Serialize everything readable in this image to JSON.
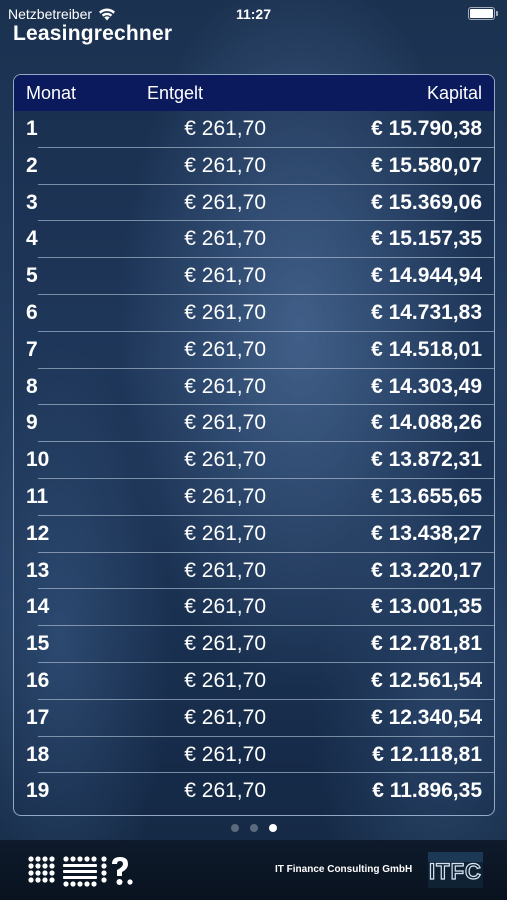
{
  "status_bar": {
    "carrier": "Netzbetreiber",
    "time": "11:27"
  },
  "app": {
    "title": "Leasingrechner"
  },
  "table": {
    "headers": {
      "month": "Monat",
      "fee": "Entgelt",
      "capital": "Kapital"
    },
    "rows": [
      {
        "month": "1",
        "fee": "€ 261,70",
        "capital": "€ 15.790,38"
      },
      {
        "month": "2",
        "fee": "€ 261,70",
        "capital": "€ 15.580,07"
      },
      {
        "month": "3",
        "fee": "€ 261,70",
        "capital": "€ 15.369,06"
      },
      {
        "month": "4",
        "fee": "€ 261,70",
        "capital": "€ 15.157,35"
      },
      {
        "month": "5",
        "fee": "€ 261,70",
        "capital": "€ 14.944,94"
      },
      {
        "month": "6",
        "fee": "€ 261,70",
        "capital": "€ 14.731,83"
      },
      {
        "month": "7",
        "fee": "€ 261,70",
        "capital": "€ 14.518,01"
      },
      {
        "month": "8",
        "fee": "€ 261,70",
        "capital": "€ 14.303,49"
      },
      {
        "month": "9",
        "fee": "€ 261,70",
        "capital": "€ 14.088,26"
      },
      {
        "month": "10",
        "fee": "€ 261,70",
        "capital": "€ 13.872,31"
      },
      {
        "month": "11",
        "fee": "€ 261,70",
        "capital": "€ 13.655,65"
      },
      {
        "month": "12",
        "fee": "€ 261,70",
        "capital": "€ 13.438,27"
      },
      {
        "month": "13",
        "fee": "€ 261,70",
        "capital": "€ 13.220,17"
      },
      {
        "month": "14",
        "fee": "€ 261,70",
        "capital": "€ 13.001,35"
      },
      {
        "month": "15",
        "fee": "€ 261,70",
        "capital": "€ 12.781,81"
      },
      {
        "month": "16",
        "fee": "€ 261,70",
        "capital": "€ 12.561,54"
      },
      {
        "month": "17",
        "fee": "€ 261,70",
        "capital": "€ 12.340,54"
      },
      {
        "month": "18",
        "fee": "€ 261,70",
        "capital": "€ 12.118,81"
      },
      {
        "month": "19",
        "fee": "€ 261,70",
        "capital": "€ 11.896,35"
      }
    ]
  },
  "pager": {
    "pages": 3,
    "current": 3
  },
  "footer": {
    "company": "IT Finance Consulting GmbH",
    "logo_text": "ITFC",
    "left_logo_icon": "dot-matrix-question-logo-icon"
  },
  "colors": {
    "header_bg": "#0a1a5c",
    "background": "#1f3757",
    "footer_bg": "#0c1727"
  }
}
